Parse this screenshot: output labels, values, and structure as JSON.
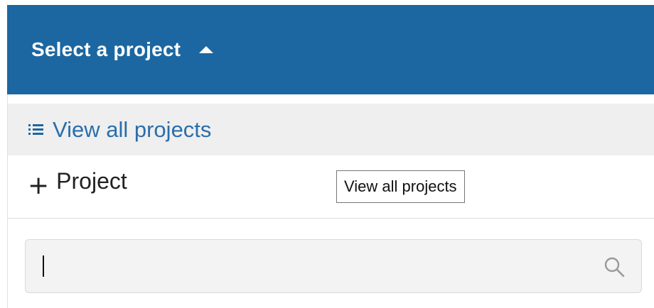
{
  "header": {
    "title": "Select a project",
    "toggle_icon": "caret-up-icon"
  },
  "menu": {
    "view_all": {
      "icon": "list-icon",
      "label": "View all projects"
    },
    "add_project": {
      "icon": "plus-icon",
      "label": "Project"
    }
  },
  "tooltip": {
    "text": "View all projects"
  },
  "search": {
    "value": "",
    "placeholder": "",
    "icon": "search-icon"
  },
  "colors": {
    "header_bg": "#1c67a1",
    "link_text": "#2a6eab",
    "hover_row_bg": "#efefef"
  }
}
